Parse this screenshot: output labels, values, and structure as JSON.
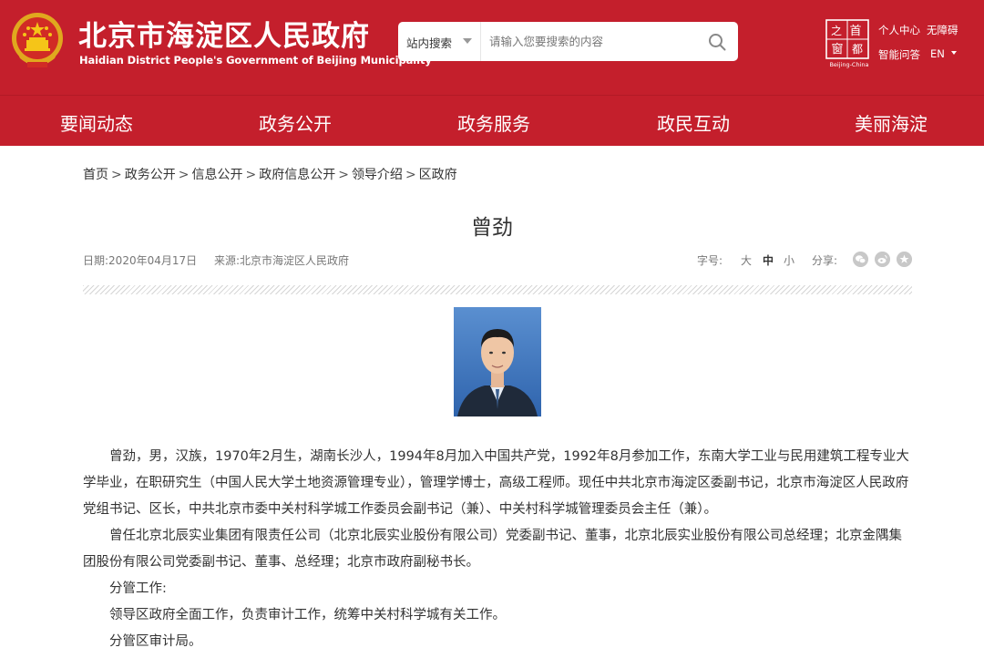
{
  "header": {
    "site_title": "北京市海淀区人民政府",
    "site_subtitle": "Haidian District People's Government of Beijing Municipality",
    "search": {
      "scope": "站内搜索",
      "placeholder": "请输入您要搜索的内容"
    },
    "capital_logo": {
      "chars": [
        "首",
        "都",
        "之",
        "窗"
      ],
      "caption": "Beijing-China"
    },
    "links": {
      "personal_center": "个人中心",
      "accessibility": "无障碍",
      "smart_qa": "智能问答",
      "language": "EN"
    },
    "brand_color": "#c41f2c"
  },
  "nav": {
    "items": [
      "要闻动态",
      "政务公开",
      "政务服务",
      "政民互动",
      "美丽海淀"
    ]
  },
  "breadcrumb": {
    "items": [
      "首页",
      "政务公开",
      "信息公开",
      "政府信息公开",
      "领导介绍",
      "区政府"
    ],
    "separator": ">"
  },
  "article": {
    "title": "曾劲",
    "date": "日期:2020年04月17日",
    "source": "来源:北京市海淀区人民政府",
    "font_size": {
      "label": "字号:",
      "options": [
        "大",
        "中",
        "小"
      ],
      "selected": "中"
    },
    "share_label": "分享:",
    "share_icons": [
      "wechat-icon",
      "weibo-icon",
      "favorite-icon"
    ],
    "paragraphs": [
      "曾劲，男，汉族，1970年2月生，湖南长沙人，1994年8月加入中国共产党，1992年8月参加工作，东南大学工业与民用建筑工程专业大学毕业，在职研究生（中国人民大学土地资源管理专业），管理学博士，高级工程师。现任中共北京市海淀区委副书记，北京市海淀区人民政府党组书记、区长，中共北京市委中关村科学城工作委员会副书记（兼）、中关村科学城管理委员会主任（兼）。",
      "曾任北京北辰实业集团有限责任公司（北京北辰实业股份有限公司）党委副书记、董事，北京北辰实业股份有限公司总经理；北京金隅集团股份有限公司党委副书记、董事、总经理；北京市政府副秘书长。",
      "分管工作:",
      "领导区政府全面工作，负责审计工作，统筹中关村科学城有关工作。",
      "分管区审计局。"
    ]
  }
}
